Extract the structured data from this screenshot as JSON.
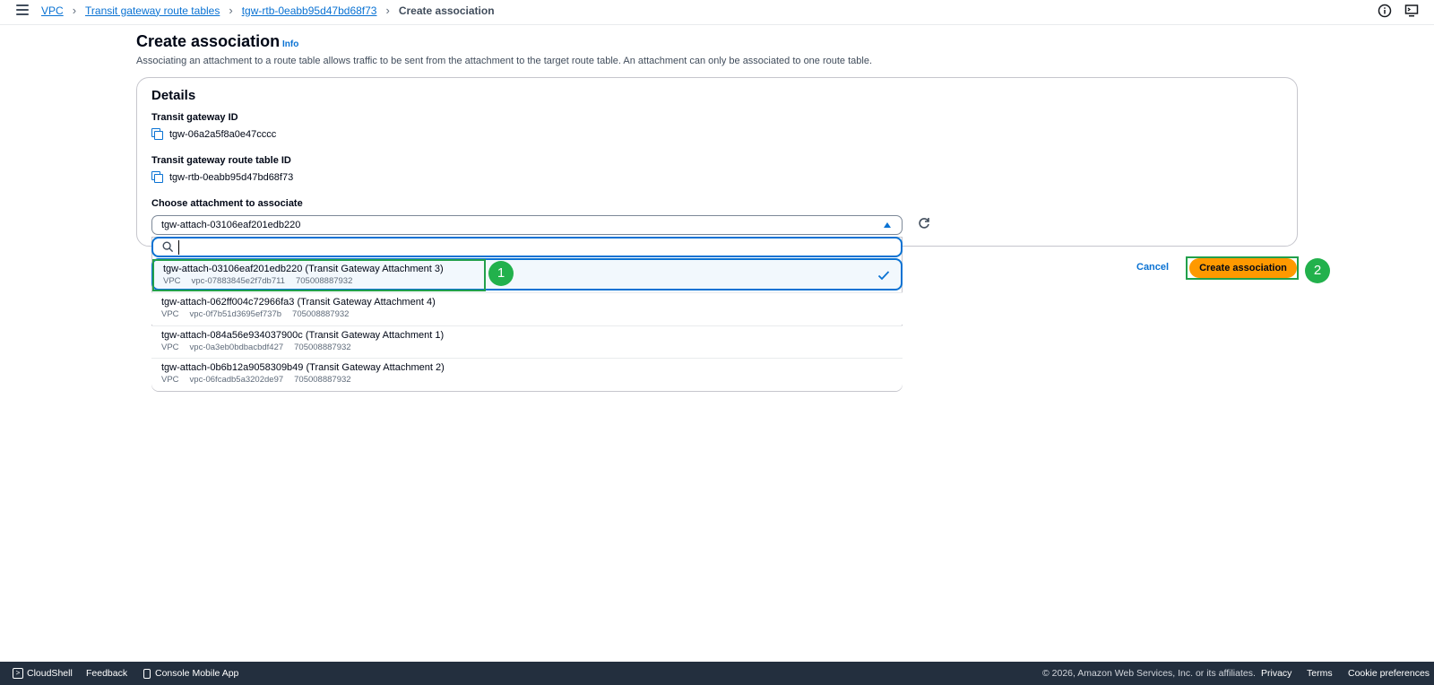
{
  "breadcrumb": {
    "items": [
      "VPC",
      "Transit gateway route tables",
      "tgw-rtb-0eabb95d47bd68f73"
    ],
    "current": "Create association"
  },
  "header": {
    "title": "Create association",
    "info_label": "Info",
    "description": "Associating an attachment to a route table allows traffic to be sent from the attachment to the target route table. An attachment can only be associated to one route table."
  },
  "details": {
    "title": "Details",
    "tgw_id_label": "Transit gateway ID",
    "tgw_id_value": "tgw-06a2a5f8a0e47cccc",
    "rtb_id_label": "Transit gateway route table ID",
    "rtb_id_value": "tgw-rtb-0eabb95d47bd68f73",
    "attachment_label": "Choose attachment to associate",
    "attachment_selected": "tgw-attach-03106eaf201edb220"
  },
  "search": {
    "placeholder": "",
    "value": ""
  },
  "options": [
    {
      "title": "tgw-attach-03106eaf201edb220 (Transit Gateway Attachment 3)",
      "type": "VPC",
      "vpc": "vpc-07883845e2f7db711",
      "account": "705008887932"
    },
    {
      "title": "tgw-attach-062ff004c72966fa3 (Transit Gateway Attachment 4)",
      "type": "VPC",
      "vpc": "vpc-0f7b51d3695ef737b",
      "account": "705008887932"
    },
    {
      "title": "tgw-attach-084a56e934037900c (Transit Gateway Attachment 1)",
      "type": "VPC",
      "vpc": "vpc-0a3eb0bdbacbdf427",
      "account": "705008887932"
    },
    {
      "title": "tgw-attach-0b6b12a9058309b49 (Transit Gateway Attachment 2)",
      "type": "VPC",
      "vpc": "vpc-06fcadb5a3202de97",
      "account": "705008887932"
    }
  ],
  "actions": {
    "cancel": "Cancel",
    "create": "Create association"
  },
  "annotations": {
    "step1": "1",
    "step2": "2"
  },
  "footer": {
    "cloudshell": "CloudShell",
    "feedback": "Feedback",
    "mobile_app": "Console Mobile App",
    "copyright": "© 2026, Amazon Web Services, Inc. or its affiliates.",
    "privacy": "Privacy",
    "terms": "Terms",
    "cookie": "Cookie preferences"
  },
  "colors": {
    "link": "#0972d3",
    "primary_button": "#ff9900",
    "highlight": "#22a04b",
    "footer_bg": "#232f3e"
  },
  "icons": [
    "menu-icon",
    "info-circle-icon",
    "cloudshell-screen-icon",
    "copy-icon",
    "caret-up-icon",
    "refresh-icon",
    "search-icon",
    "check-icon",
    "phone-icon"
  ]
}
